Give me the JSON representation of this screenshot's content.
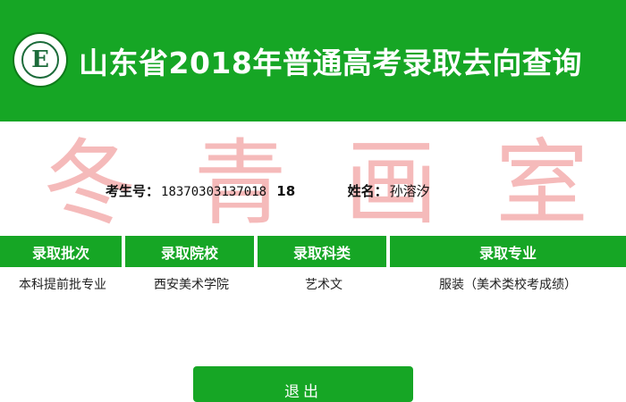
{
  "header": {
    "title": "山东省2018年普通高考录取去向查询",
    "logo_letter": "E",
    "logo_icon": "school-seal-logo",
    "bg_color": "#16a625"
  },
  "watermark": {
    "chars": [
      "冬",
      "青",
      "画",
      "室"
    ],
    "color": "#f2a4a4"
  },
  "examinee": {
    "no_label": "考生号：",
    "no_value": "18370303137018",
    "no_suffix": "18",
    "name_label": "姓名：",
    "name_value": "孙溶汐"
  },
  "table": {
    "headers": [
      "录取批次",
      "录取院校",
      "录取科类",
      "录取专业"
    ],
    "row": [
      "本科提前批专业",
      "西安美术学院",
      "艺术文",
      "服装（美术类校考成绩）"
    ]
  },
  "actions": {
    "exit_label": "退出"
  }
}
